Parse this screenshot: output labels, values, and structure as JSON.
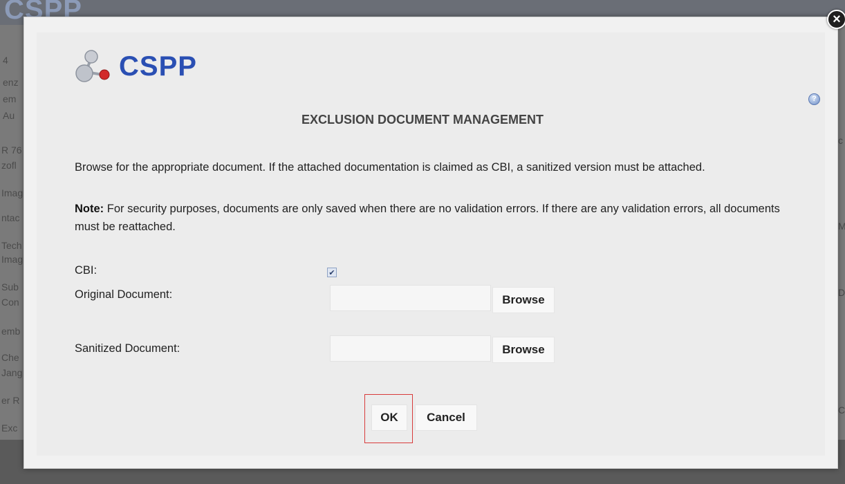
{
  "background": {
    "logo_text": "CSPP",
    "left_fragments": [
      "4",
      "enz",
      "em",
      "Au",
      "R 76",
      "zofl",
      "Imag",
      "ntac",
      "Tech",
      "Imag",
      "Sub",
      "Con",
      "emb",
      "Che",
      "Jang",
      "er R",
      "Exc"
    ],
    "right_fragments": [
      "c",
      "M",
      "D",
      "C"
    ]
  },
  "modal": {
    "logo_text": "CSPP",
    "help_glyph": "?",
    "close_glyph": "×",
    "title": "EXCLUSION DOCUMENT MANAGEMENT",
    "instructions": "Browse for the appropriate document. If the attached documentation is claimed as CBI, a sanitized version must be attached.",
    "note_label": "Note:",
    "note_text": " For security purposes, documents are only saved when there are no validation errors. If there are any validation errors, all documents must be reattached.",
    "form": {
      "cbi_label": "CBI:",
      "cbi_checked": true,
      "cbi_check_glyph": "✔",
      "original_label": "Original Document:",
      "sanitized_label": "Sanitized Document:",
      "browse_label": "Browse"
    },
    "buttons": {
      "ok": "OK",
      "cancel": "Cancel"
    }
  },
  "colors": {
    "brand_blue": "#2a4fb3",
    "highlight_red": "#d83a3a"
  }
}
